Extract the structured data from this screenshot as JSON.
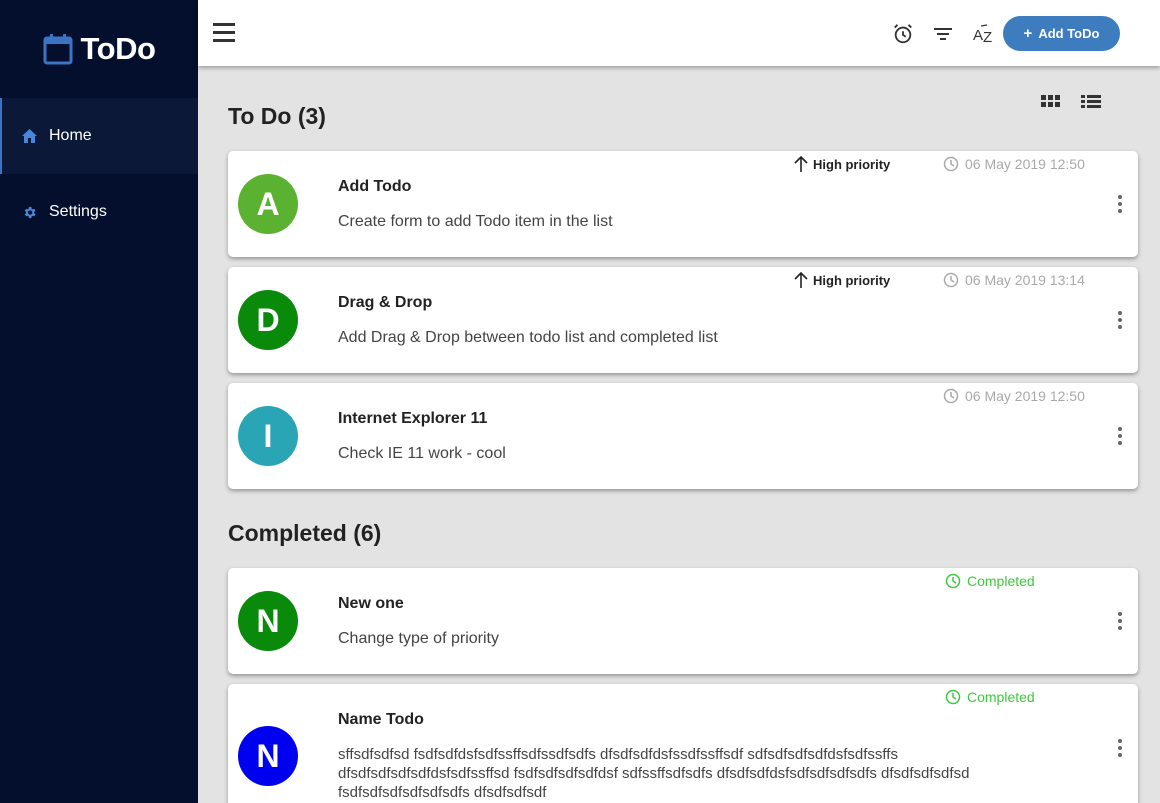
{
  "app": {
    "name": "ToDo",
    "brand_color": "#3b74c4"
  },
  "sidebar": {
    "items": [
      {
        "label": "Home",
        "icon": "home-icon",
        "active": true
      },
      {
        "label": "Settings",
        "icon": "gear-icon",
        "active": false
      }
    ]
  },
  "header": {
    "icons": [
      "menu-icon",
      "alarm-icon",
      "filter-icon",
      "sort-az-icon"
    ],
    "add_button": {
      "plus": "+",
      "label": "Add ToDo"
    }
  },
  "todo_section": {
    "title": "To Do (3)",
    "view_icons": [
      "grid-view-icon",
      "list-view-icon"
    ],
    "items": [
      {
        "letter": "A",
        "avatar_color": "#5bb230",
        "title": "Add Todo",
        "description": "Create form to add Todo item in the list",
        "priority": "High priority",
        "date": "06 May 2019 12:50"
      },
      {
        "letter": "D",
        "avatar_color": "#0a8a0a",
        "title": "Drag & Drop",
        "description": "Add Drag & Drop between todo list and completed list",
        "priority": "High priority",
        "date": "06 May 2019 13:14"
      },
      {
        "letter": "I",
        "avatar_color": "#2aa5b5",
        "title": "Internet Explorer 11",
        "description": "Check IE 11 work - cool",
        "priority": "",
        "date": "06 May 2019 12:50"
      }
    ]
  },
  "completed_section": {
    "title": "Completed (6)",
    "items": [
      {
        "letter": "N",
        "avatar_color": "#0a8a0a",
        "title": "New one",
        "description": "Change type of priority",
        "status": "Completed"
      },
      {
        "letter": "N",
        "avatar_color": "#0000f0",
        "title": "Name Todo",
        "description": "sffsdfsdfsd fsdfsdfdsfsdfssffsdfssdfsdfs dfsdfsdfdsfssdfssffsdf sdfsdfsdfsdfdsfsdfssffs dfsdfsdfsdfsdfdsfsdfssffsd fsdfsdfsdfsdfdsf sdfssffsdfsdfs dfsdfsdfdsfsdfsdfsdfsdfs dfsdfsdfsdfsd fsdfsdfsdfsdfsdfsdfs dfsdfsdfsdf",
        "status": "Completed"
      }
    ]
  }
}
